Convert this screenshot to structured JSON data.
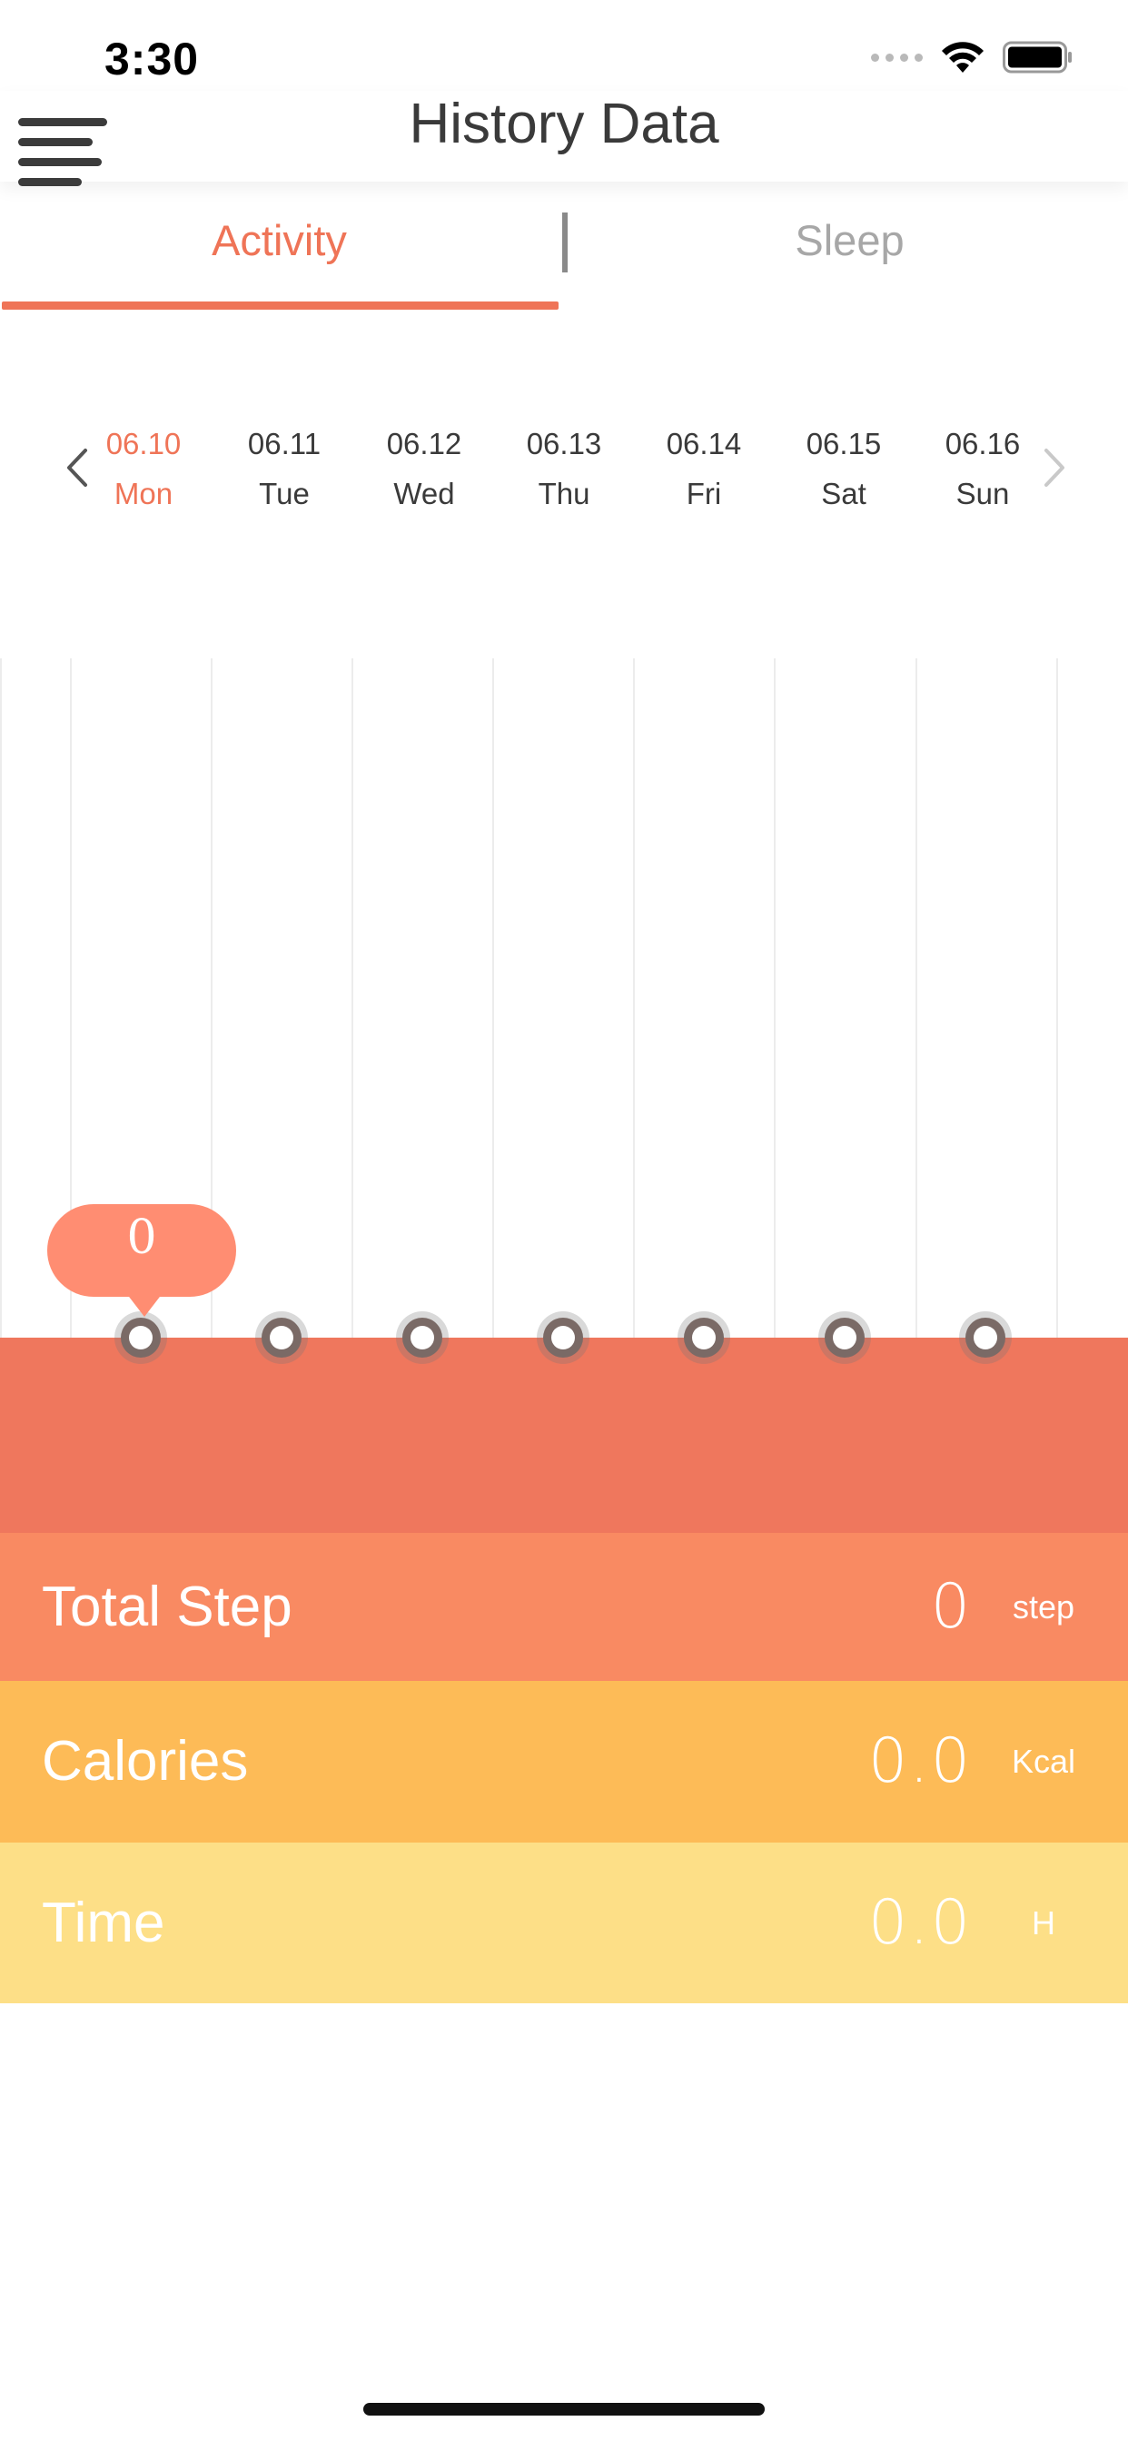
{
  "status_bar": {
    "time": "3:30"
  },
  "header": {
    "title": "History Data"
  },
  "tabs": [
    {
      "label": "Activity",
      "active": true
    },
    {
      "label": "Sleep",
      "active": false
    }
  ],
  "colors": {
    "accent": "#ef7457",
    "chart_fill": "#ef775d",
    "steps_row": "#f98a62",
    "calories_row": "#fdbb57",
    "time_row": "#fddf87"
  },
  "days": [
    {
      "date": "06.10",
      "weekday": "Mon",
      "selected": true
    },
    {
      "date": "06.11",
      "weekday": "Tue",
      "selected": false
    },
    {
      "date": "06.12",
      "weekday": "Wed",
      "selected": false
    },
    {
      "date": "06.13",
      "weekday": "Thu",
      "selected": false
    },
    {
      "date": "06.14",
      "weekday": "Fri",
      "selected": false
    },
    {
      "date": "06.15",
      "weekday": "Sat",
      "selected": false
    },
    {
      "date": "06.16",
      "weekday": "Sun",
      "selected": false
    }
  ],
  "chart_data": {
    "type": "area",
    "categories": [
      "06.10",
      "06.11",
      "06.12",
      "06.13",
      "06.14",
      "06.15",
      "06.16"
    ],
    "values": [
      0,
      0,
      0,
      0,
      0,
      0,
      0
    ],
    "selected_label": "0"
  },
  "stats": {
    "total_step": {
      "label": "Total Step",
      "value": "0",
      "unit": "step"
    },
    "calories": {
      "label": "Calories",
      "value": "0.0",
      "unit": "Kcal"
    },
    "time": {
      "label": "Time",
      "value": "0.0",
      "unit": "H"
    }
  }
}
